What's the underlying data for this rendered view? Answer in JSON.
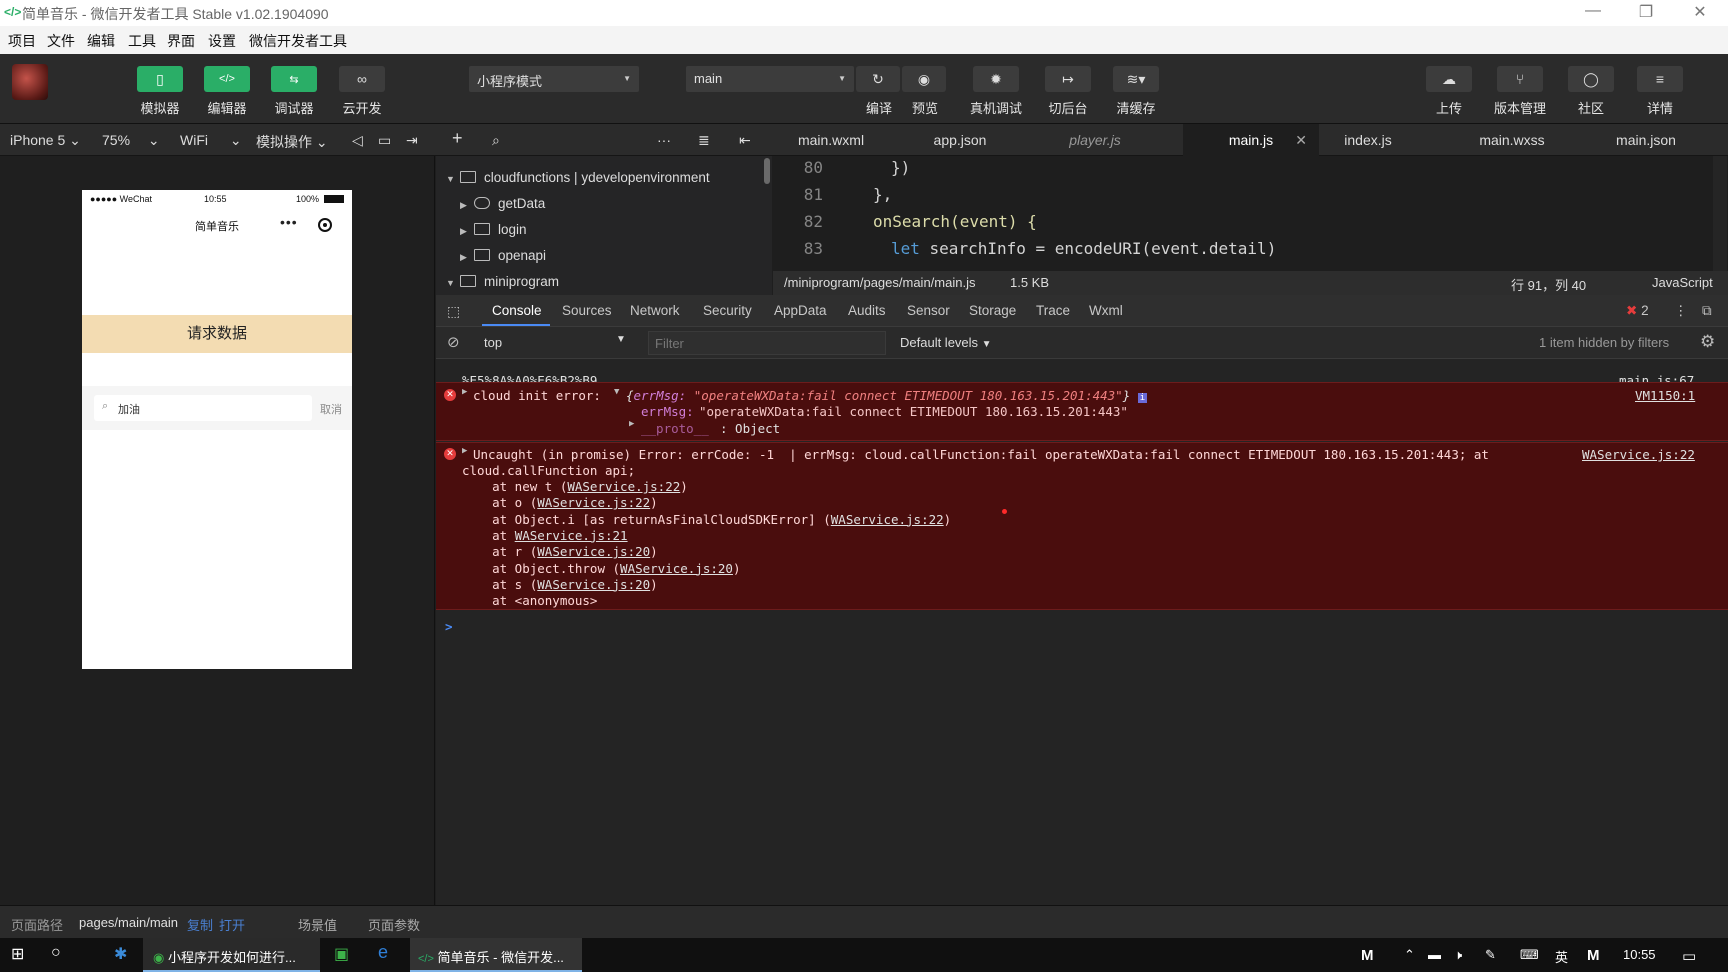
{
  "window": {
    "title": "简单音乐 - 微信开发者工具 Stable v1.02.1904090"
  },
  "menu": [
    "项目",
    "文件",
    "编辑",
    "工具",
    "界面",
    "设置",
    "微信开发者工具"
  ],
  "toolbar": {
    "left_buttons": [
      "模拟器",
      "编辑器",
      "调试器",
      "云开发"
    ],
    "mode_select": "小程序模式",
    "compile_select": "main",
    "mid_buttons": [
      "编译",
      "预览",
      "真机调试",
      "切后台",
      "清缓存"
    ],
    "right_buttons": [
      "上传",
      "版本管理",
      "社区",
      "详情"
    ]
  },
  "subbar": {
    "device": "iPhone 5",
    "zoom": "75%",
    "network": "WiFi",
    "sim_ops": "模拟操作"
  },
  "editor_tabs": [
    "main.wxml",
    "app.json",
    "player.js",
    "main.js",
    "index.js",
    "main.wxss",
    "main.json"
  ],
  "filetree": {
    "root": "cloudfunctions | ydevelopenvironment",
    "children": [
      "getData",
      "login",
      "openapi"
    ],
    "sibling": "miniprogram"
  },
  "phone": {
    "carrier": "●●●●● WeChat",
    "time": "10:55",
    "battery": "100%",
    "nav_title": "简单音乐",
    "request_button": "请求数据",
    "search_value": "加油",
    "cancel": "取消"
  },
  "code": {
    "lines": [
      {
        "num": "80",
        "text": "})"
      },
      {
        "num": "81",
        "text": "},"
      },
      {
        "num": "82",
        "text": "onSearch(event) {"
      },
      {
        "num": "83",
        "kw": "let",
        "rest": " searchInfo = encodeURI(event.detail)"
      }
    ]
  },
  "editor_status": {
    "path": "/miniprogram/pages/main/main.js",
    "size": "1.5 KB",
    "cursor": "行 91，列 40",
    "language": "JavaScript"
  },
  "devtools": {
    "tabs": [
      "Console",
      "Sources",
      "Network",
      "Security",
      "AppData",
      "Audits",
      "Sensor",
      "Storage",
      "Trace",
      "Wxml"
    ],
    "error_count": "2",
    "context": "top",
    "filter_placeholder": "Filter",
    "levels": "Default levels",
    "hidden_note": "1 item hidden by filters"
  },
  "console": {
    "log1": {
      "text": "%E5%8A%A0%E6%B2%B9",
      "source": "main.js:67"
    },
    "err1": {
      "label": "cloud init error:",
      "obj_head_key": "errMsg:",
      "obj_head_val": "\"operateWXData:fail connect ETIMEDOUT 180.163.15.201:443\"",
      "prop_key": "errMsg:",
      "prop_val": "\"operateWXData:fail connect ETIMEDOUT 180.163.15.201:443\"",
      "proto_key": "__proto__",
      "proto_val": ": Object",
      "source": "VM1150:1"
    },
    "err2": {
      "line1": "Uncaught (in promise) Error: errCode: -1  | errMsg: cloud.callFunction:fail operateWXData:fail connect ETIMEDOUT 180.163.15.201:443; at",
      "line2": "cloud.callFunction api;",
      "stack": [
        {
          "pre": "    at new t (",
          "link": "WAService.js:22",
          "post": ")"
        },
        {
          "pre": "    at o (",
          "link": "WAService.js:22",
          "post": ")"
        },
        {
          "pre": "    at Object.i [as returnAsFinalCloudSDKError] (",
          "link": "WAService.js:22",
          "post": ")"
        },
        {
          "pre": "    at ",
          "link": "WAService.js:21",
          "post": ""
        },
        {
          "pre": "    at r (",
          "link": "WAService.js:20",
          "post": ")"
        },
        {
          "pre": "    at Object.throw (",
          "link": "WAService.js:20",
          "post": ")"
        },
        {
          "pre": "    at s (",
          "link": "WAService.js:20",
          "post": ")"
        },
        {
          "pre": "    at <anonymous>",
          "link": "",
          "post": ""
        }
      ],
      "source": "WAService.js:22"
    },
    "prompt": ">"
  },
  "footer": {
    "path_label": "页面路径",
    "path": "pages/main/main",
    "copy": "复制",
    "open": "打开",
    "scene": "场景值",
    "params": "页面参数"
  },
  "taskbar": {
    "app1": "小程序开发如何进行...",
    "app2": "简单音乐 - 微信开发...",
    "lang": "英",
    "time": "10:55"
  }
}
